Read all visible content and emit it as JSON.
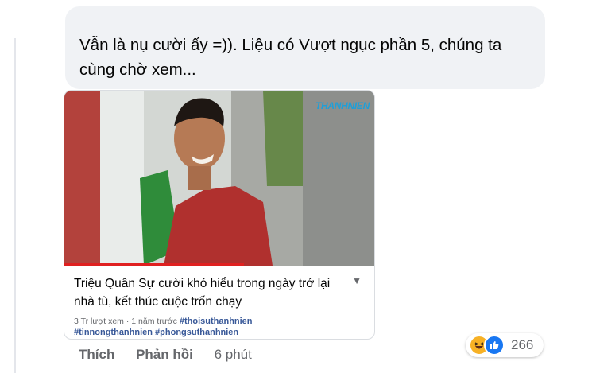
{
  "comment": {
    "text_line1": "Vẫn là nụ cười ấy =)). Liệu có Vượt ngục phần 5, chúng ta",
    "text_line2": "cùng chờ xem..."
  },
  "video_card": {
    "watermark": "THANHNIEN",
    "title": "Triệu Quân Sự cười khó hiểu trong ngày trở lại nhà tù, kết thúc cuộc trốn chạy",
    "meta": "3 Tr lượt xem · 1 năm trước",
    "tag1": "#thoisuthanhnien",
    "tag2": "#tinnongthanhnien",
    "tag3": "#phongsuthanhnien",
    "expand_icon": "chevron-down-icon",
    "progress": 0.58
  },
  "actions": {
    "like_label": "Thích",
    "reply_label": "Phản hồi",
    "time": "6 phút"
  },
  "reactions": {
    "icons": [
      "haha-icon",
      "like-icon"
    ],
    "count": "266"
  },
  "colors": {
    "bubble_bg": "#f0f2f5",
    "link": "#385898",
    "like_blue": "#1877f2",
    "haha_yellow": "#f7b125",
    "meta_gray": "#65676b"
  }
}
